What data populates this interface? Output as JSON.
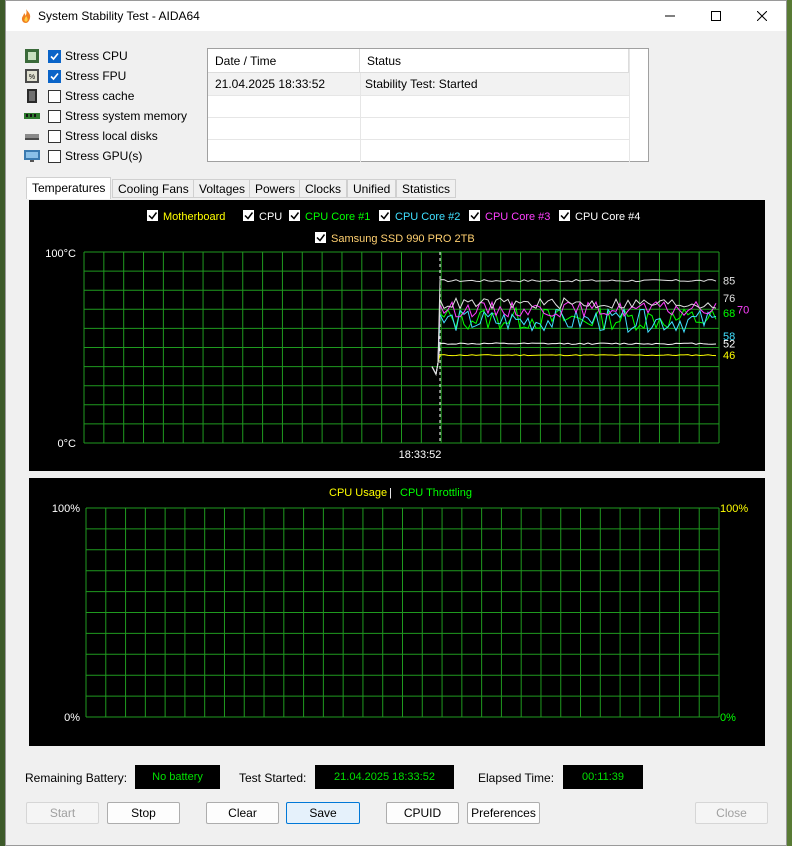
{
  "window": {
    "title": "System Stability Test - AIDA64"
  },
  "stress": [
    {
      "label": "Stress CPU",
      "checked": true,
      "icon": "cpu-chip-icon"
    },
    {
      "label": "Stress FPU",
      "checked": true,
      "icon": "fpu-chip-icon"
    },
    {
      "label": "Stress cache",
      "checked": false,
      "icon": "cache-chip-icon"
    },
    {
      "label": "Stress system memory",
      "checked": false,
      "icon": "memory-module-icon"
    },
    {
      "label": "Stress local disks",
      "checked": false,
      "icon": "disk-drive-icon"
    },
    {
      "label": "Stress GPU(s)",
      "checked": false,
      "icon": "gpu-monitor-icon"
    }
  ],
  "log": {
    "headers": [
      "Date / Time",
      "Status"
    ],
    "rows": [
      {
        "datetime": "21.04.2025 18:33:52",
        "status": "Stability Test: Started"
      }
    ]
  },
  "tabs": [
    "Temperatures",
    "Cooling Fans",
    "Voltages",
    "Powers",
    "Clocks",
    "Unified",
    "Statistics"
  ],
  "temp_graph": {
    "legend": [
      {
        "label": "Motherboard",
        "color": "#ffff00"
      },
      {
        "label": "CPU",
        "color": "#ffffff"
      },
      {
        "label": "CPU Core #1",
        "color": "#00ff00"
      },
      {
        "label": "CPU Core #2",
        "color": "#40e0ff"
      },
      {
        "label": "CPU Core #3",
        "color": "#ff40ff"
      },
      {
        "label": "CPU Core #4",
        "color": "#ffffff"
      },
      {
        "label": "Samsung SSD 990 PRO 2TB",
        "color": "#ffd070"
      }
    ],
    "y_top": "100°C",
    "y_bottom": "0°C",
    "x_marker": "18:33:52",
    "readouts": [
      {
        "value": "85",
        "color": "#e0e0e0",
        "temp": 85
      },
      {
        "value": "76",
        "color": "#e0e0e0",
        "temp": 76
      },
      {
        "value": "70",
        "color": "#ff40ff",
        "temp": 70
      },
      {
        "value": "68",
        "color": "#00ff00",
        "temp": 68
      },
      {
        "value": "58",
        "color": "#40e0ff",
        "temp": 58
      },
      {
        "value": "52",
        "color": "#ffffff",
        "temp": 52
      },
      {
        "value": "46",
        "color": "#ffff00",
        "temp": 46
      }
    ]
  },
  "usage_graph": {
    "legend_usage": "CPU Usage",
    "legend_sep": "|",
    "legend_throttle": "CPU Throttling",
    "y_top_left": "100%",
    "y_bottom_left": "0%",
    "y_top_right": "100%",
    "y_bottom_right": "0%",
    "usage_color": "#ffff00",
    "throttle_color": "#00ff00"
  },
  "status": {
    "battery_label": "Remaining Battery:",
    "battery_value": "No battery",
    "started_label": "Test Started:",
    "started_value": "21.04.2025 18:33:52",
    "elapsed_label": "Elapsed Time:",
    "elapsed_value": "00:11:39"
  },
  "buttons": {
    "start": "Start",
    "stop": "Stop",
    "clear": "Clear",
    "save": "Save",
    "cpuid": "CPUID",
    "preferences": "Preferences",
    "close": "Close"
  }
}
